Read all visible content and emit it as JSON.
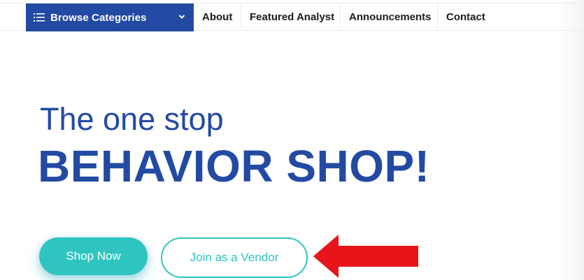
{
  "nav": {
    "browse_label": "Browse Categories",
    "items": [
      {
        "label": "About"
      },
      {
        "label": "Featured Analyst"
      },
      {
        "label": "Announcements"
      },
      {
        "label": "Contact"
      }
    ]
  },
  "hero": {
    "line1": "The one stop",
    "line2": "BEHAVIOR SHOP!"
  },
  "buttons": {
    "shop_now": "Shop Now",
    "join_vendor": "Join as a Vendor"
  },
  "colors": {
    "brand_blue": "#234aa3",
    "accent_teal": "#2ec5c0",
    "annotation_arrow": "#e8141a"
  },
  "icons": {
    "browse_menu": "list-icon",
    "browse_dropdown": "chevron-down-icon",
    "annotation": "left-arrow-icon"
  }
}
